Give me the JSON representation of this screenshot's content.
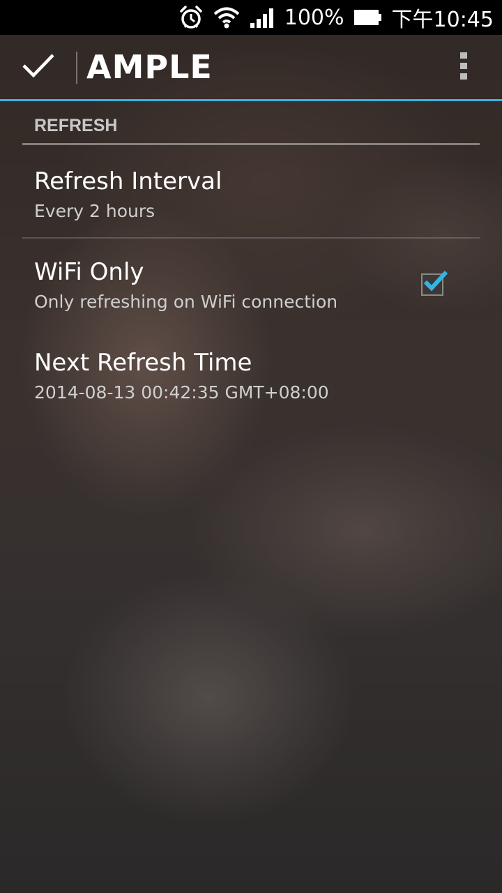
{
  "status_bar": {
    "battery": "100%",
    "time": "下午10:45",
    "icons": [
      "alarm-icon",
      "wifi-icon",
      "signal-icon",
      "battery-icon"
    ]
  },
  "action_bar": {
    "title": "AMPLE",
    "done_icon": "check-icon",
    "overflow_icon": "overflow-menu-icon",
    "accent_color": "#33b5e5"
  },
  "preferences": {
    "category": "REFRESH",
    "items": [
      {
        "title": "Refresh Interval",
        "summary": "Every 2 hours"
      },
      {
        "title": "WiFi Only",
        "summary": "Only refreshing on WiFi connection",
        "checked": true
      },
      {
        "title": "Next Refresh Time",
        "summary": "2014-08-13 00:42:35 GMT+08:00"
      }
    ]
  }
}
